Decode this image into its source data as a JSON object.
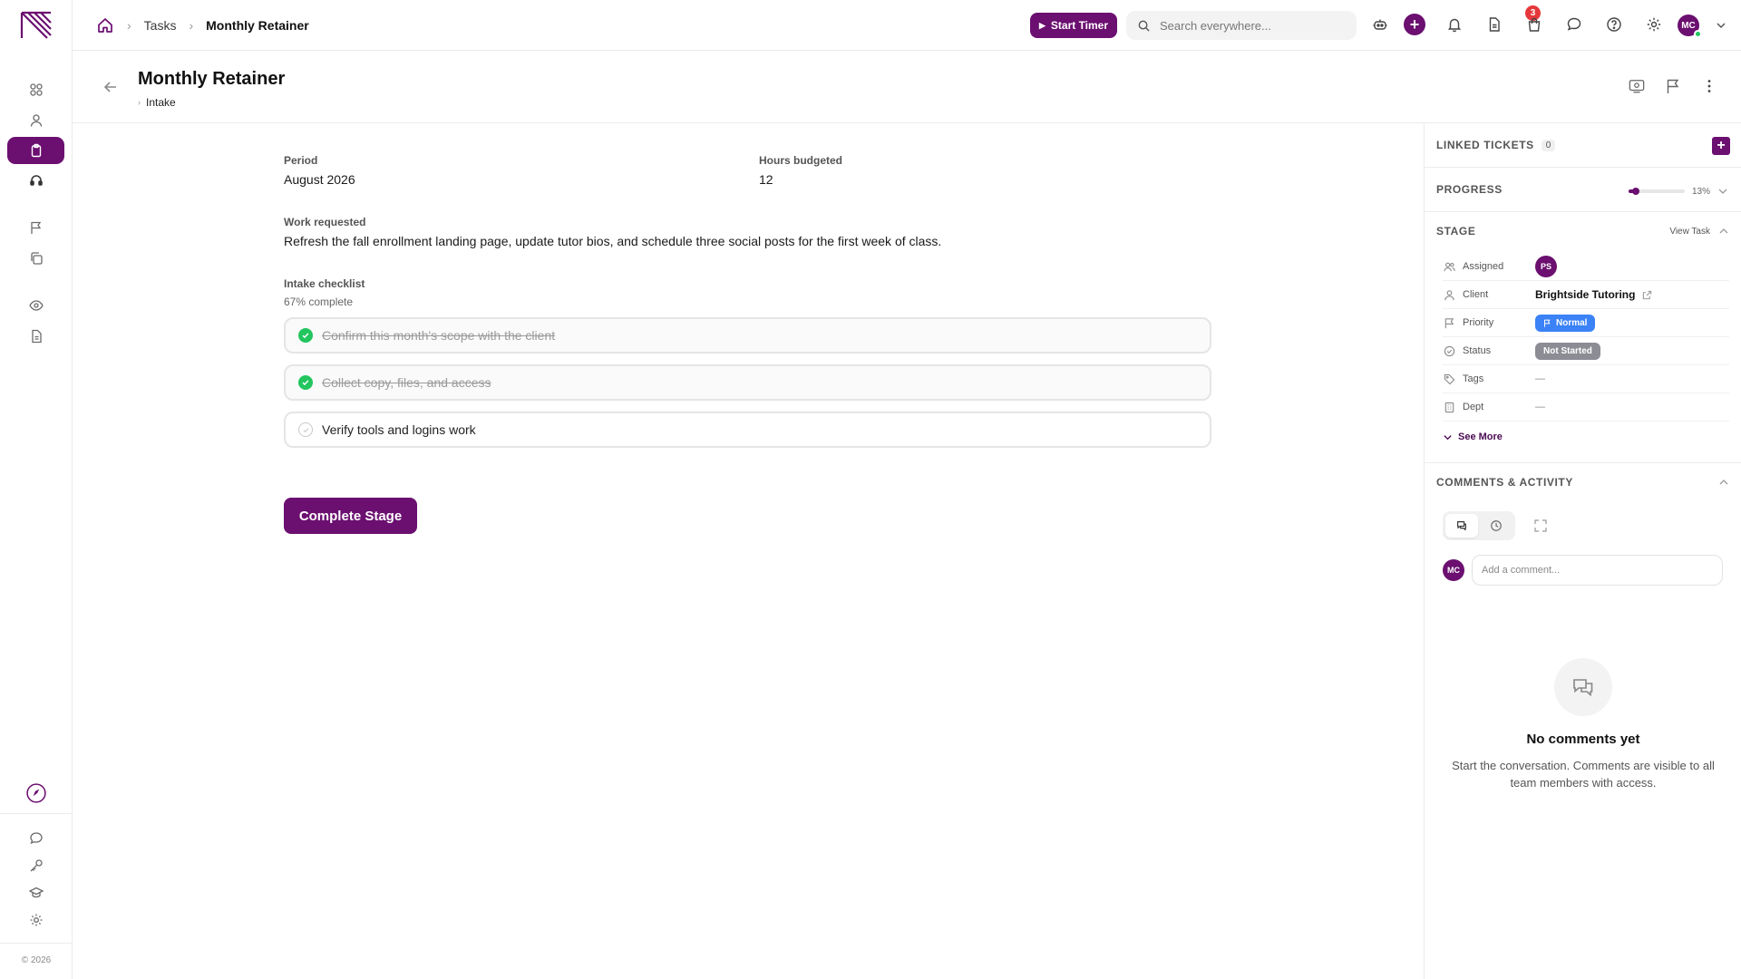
{
  "topbar": {
    "breadcrumb": [
      "Tasks",
      "Monthly Retainer"
    ],
    "timer_label": "Start Timer",
    "search_placeholder": "Search everywhere...",
    "notification_count": "3",
    "user_initials": "MC"
  },
  "page": {
    "title": "Monthly Retainer",
    "subtitle": "Intake"
  },
  "details": {
    "period_label": "Period",
    "period_value": "August 2026",
    "hours_label": "Hours budgeted",
    "hours_value": "12",
    "work_label": "Work requested",
    "work_value": "Refresh the fall enrollment landing page, update tutor bios, and schedule three social posts for the first week of class.",
    "checklist_label": "Intake checklist",
    "checklist_progress": "67% complete",
    "checklist": [
      {
        "text": "Confirm this month's scope with the client",
        "done": true
      },
      {
        "text": "Collect copy, files, and access",
        "done": true
      },
      {
        "text": "Verify tools and logins work",
        "done": false
      }
    ],
    "complete_label": "Complete Stage"
  },
  "panel": {
    "linked_title": "LINKED TICKETS",
    "linked_count": "0",
    "progress_title": "PROGRESS",
    "progress_percent": 13,
    "progress_text": "13%",
    "stage_title": "STAGE",
    "view_task": "View Task",
    "props": {
      "assigned_label": "Assigned",
      "assigned_initials": "PS",
      "client_label": "Client",
      "client_value": "Brightside Tutoring",
      "priority_label": "Priority",
      "priority_value": "Normal",
      "status_label": "Status",
      "status_value": "Not Started",
      "tags_label": "Tags",
      "tags_value": "—",
      "dept_label": "Dept",
      "dept_value": "—"
    },
    "see_more": "See More",
    "comments_title": "COMMENTS & ACTIVITY",
    "comment_user_initials": "MC",
    "comment_placeholder": "Add a comment...",
    "empty_title": "No comments yet",
    "empty_sub": "Start the conversation. Comments are visible to all team members with access."
  },
  "footer": {
    "copyright": "© 2026"
  },
  "colors": {
    "brand": "#6b0f70",
    "success": "#22c55e",
    "priority_normal": "#3b82f6",
    "status_not_started": "#8c8c95",
    "badge": "#e5383b"
  }
}
